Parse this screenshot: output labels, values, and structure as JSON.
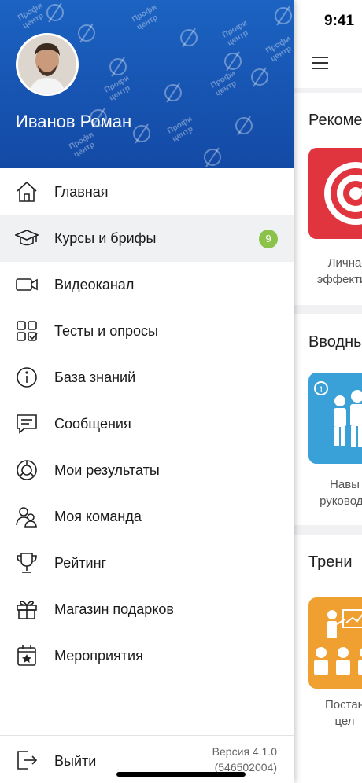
{
  "status_bar": {
    "time": "9:41"
  },
  "drawer": {
    "user_name": "Иванов Роман",
    "brand_pattern_text": "Профи центр",
    "menu": [
      {
        "label": "Главная",
        "icon": "home-icon"
      },
      {
        "label": "Курсы и брифы",
        "icon": "graduation-cap-icon",
        "badge": "9",
        "active": true
      },
      {
        "label": "Видеоканал",
        "icon": "video-camera-icon"
      },
      {
        "label": "Тесты и опросы",
        "icon": "tests-grid-icon"
      },
      {
        "label": "База знаний",
        "icon": "info-icon"
      },
      {
        "label": "Сообщения",
        "icon": "message-icon"
      },
      {
        "label": "Мои результаты",
        "icon": "results-chart-icon"
      },
      {
        "label": "Моя команда",
        "icon": "team-icon"
      },
      {
        "label": "Рейтинг",
        "icon": "trophy-icon"
      },
      {
        "label": "Магазин подарков",
        "icon": "gift-icon"
      },
      {
        "label": "Мероприятия",
        "icon": "calendar-star-icon"
      }
    ],
    "footer": {
      "logout_label": "Выйти",
      "version_line1": "Версия 4.1.0",
      "version_line2": "(546502004)"
    }
  },
  "main": {
    "sections": [
      {
        "title": "Рекоме",
        "card_caption_line1": "Лична",
        "card_caption_line2": "эффектив",
        "card_color": "#e0343f"
      },
      {
        "title": "Вводны",
        "card_caption_line1": "Навы",
        "card_caption_line2": "руководи",
        "card_color": "#3aa0d8"
      },
      {
        "title": "Трени",
        "card_caption_line1": "Постан",
        "card_caption_line2": "цел",
        "card_color": "#f0a030"
      }
    ]
  },
  "colors": {
    "drawer_header": "#1753b0",
    "badge": "#8bc34a",
    "active_row": "#f0f1f2"
  }
}
